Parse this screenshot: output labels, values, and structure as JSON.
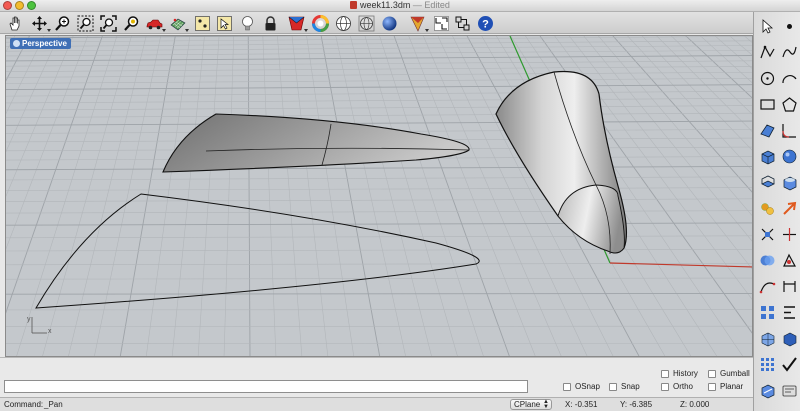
{
  "window": {
    "title": "week11.3dm",
    "status": "— Edited"
  },
  "toolbar": {
    "icons": [
      "hand-pan-icon",
      "move-arrows-icon",
      "zoom-icon",
      "zoom-window-icon",
      "zoom-extents-icon",
      "zoom-selected-icon",
      "car-icon",
      "grid-dots-icon",
      "point-on-icon",
      "light-bulb-icon",
      "lock-icon",
      "render-mode-icon",
      "color-wheel-icon",
      "wireframe-sphere-icon",
      "ghosted-sphere-icon",
      "shaded-sphere-icon",
      "cut-plane-icon",
      "gumball-transform-icon",
      "help-icon"
    ]
  },
  "viewport": {
    "name": "Perspective",
    "axis_y": "y",
    "axis_x": "x",
    "background": "#c4c8cc",
    "x_axis_color": "#c0392b",
    "y_axis_color": "#2e9a2e"
  },
  "command": {
    "value": "",
    "prompt_label": "Command:",
    "last_command": "_Pan"
  },
  "toggles": {
    "history": "History",
    "gumball": "Gumball",
    "osnap": "OSnap",
    "snap": "Snap",
    "ortho": "Ortho",
    "planar": "Planar"
  },
  "status": {
    "cplane": "CPlane",
    "x": "X: -0.351",
    "y": "Y: -6.385",
    "z": "Z: 0.000"
  },
  "sidebar": {
    "icons": [
      "select-arrow-icon",
      "point-icon",
      "polyline-icon",
      "curve-icon",
      "circle-icon",
      "arc-icon",
      "rectangle-icon",
      "polygon-icon",
      "surface-icon",
      "fillet-icon",
      "box-solid-icon",
      "sphere-solid-icon",
      "extrude-icon",
      "cap-icon",
      "transform-icon",
      "explode-icon",
      "trim-icon",
      "split-icon",
      "boolean-icon",
      "analysis-icon",
      "curve-edit-icon",
      "dimension-icon",
      "array-icon",
      "align-icon",
      "mesh-icon",
      "render-icon",
      "grid-array-icon",
      "check-icon",
      "block-icon",
      "options-icon"
    ]
  }
}
